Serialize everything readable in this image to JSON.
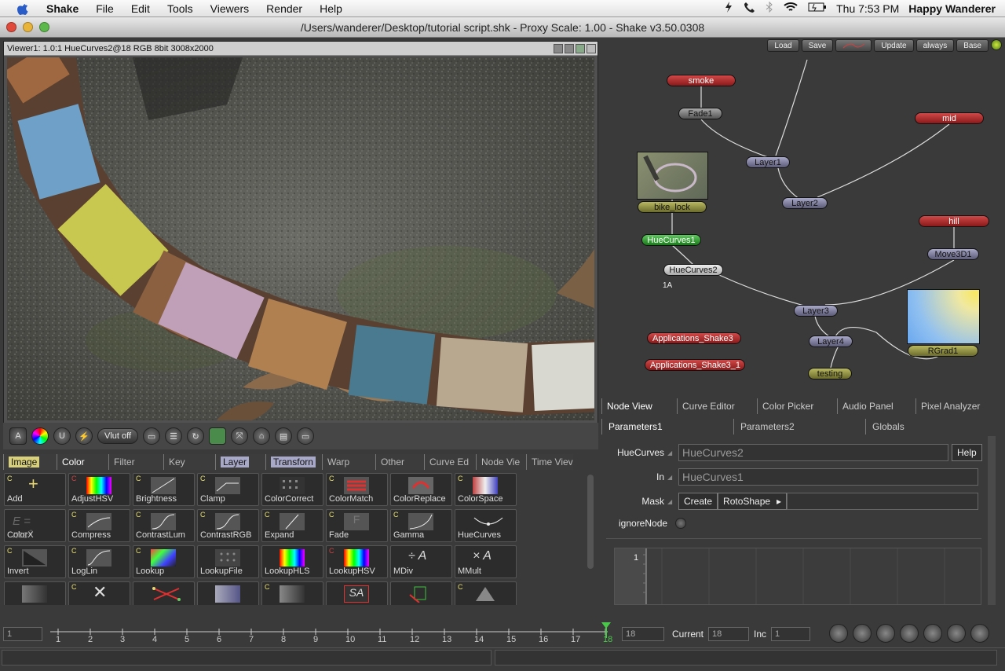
{
  "menubar": {
    "app": "Shake",
    "items": [
      "File",
      "Edit",
      "Tools",
      "Viewers",
      "Render",
      "Help"
    ],
    "clock": "Thu 7:53 PM",
    "user": "Happy Wanderer",
    "status_icons": [
      "spotlight-icon",
      "phone-icon",
      "bluetooth-icon",
      "wifi-icon",
      "battery-icon"
    ]
  },
  "window": {
    "title": "/Users/wanderer/Desktop/tutorial script.shk - Proxy Scale: 1.00 - Shake v3.50.0308"
  },
  "viewer": {
    "header": "Viewer1: 1.0:1 HueCurves2@18 RGB 8bit 3008x2000",
    "vlut_label": "Vlut off"
  },
  "tool_tabs": [
    {
      "label": "Image",
      "style": "hl"
    },
    {
      "label": "Color",
      "style": "sel"
    },
    {
      "label": "Filter",
      "style": ""
    },
    {
      "label": "Key",
      "style": ""
    },
    {
      "label": "Layer",
      "style": "hlb"
    },
    {
      "label": "Transforn",
      "style": "hlb"
    },
    {
      "label": "Warp",
      "style": ""
    },
    {
      "label": "Other",
      "style": ""
    },
    {
      "label": "Curve Ed",
      "style": ""
    },
    {
      "label": "Node Vie",
      "style": ""
    },
    {
      "label": "Time Viev",
      "style": ""
    }
  ],
  "tools": [
    {
      "label": "Add",
      "c": "C",
      "cred": false
    },
    {
      "label": "AdjustHSV",
      "c": "C",
      "cred": true
    },
    {
      "label": "Brightness",
      "c": "C",
      "cred": false
    },
    {
      "label": "Clamp",
      "c": "C",
      "cred": false
    },
    {
      "label": "ColorCorrect",
      "c": "",
      "cred": false
    },
    {
      "label": "ColorMatch",
      "c": "C",
      "cred": false
    },
    {
      "label": "ColorReplace",
      "c": "",
      "cred": false
    },
    {
      "label": "ColorSpace",
      "c": "C",
      "cred": false
    },
    {
      "label": "ColorX",
      "c": "",
      "cred": false
    },
    {
      "label": "Compress",
      "c": "C",
      "cred": false
    },
    {
      "label": "ContrastLum",
      "c": "C",
      "cred": false
    },
    {
      "label": "ContrastRGB",
      "c": "C",
      "cred": false
    },
    {
      "label": "Expand",
      "c": "C",
      "cred": false
    },
    {
      "label": "Fade",
      "c": "C",
      "cred": false
    },
    {
      "label": "Gamma",
      "c": "C",
      "cred": false
    },
    {
      "label": "HueCurves",
      "c": "",
      "cred": false
    },
    {
      "label": "Invert",
      "c": "C",
      "cred": false
    },
    {
      "label": "LogLin",
      "c": "C",
      "cred": false
    },
    {
      "label": "Lookup",
      "c": "C",
      "cred": false
    },
    {
      "label": "LookupFile",
      "c": "",
      "cred": false
    },
    {
      "label": "LookupHLS",
      "c": "",
      "cred": false
    },
    {
      "label": "LookupHSV",
      "c": "C",
      "cred": true
    },
    {
      "label": "MDiv",
      "c": "",
      "cred": false
    },
    {
      "label": "MMult",
      "c": "",
      "cred": false
    },
    {
      "label": "",
      "c": "",
      "cred": false
    },
    {
      "label": "",
      "c": "C",
      "cred": false
    },
    {
      "label": "",
      "c": "",
      "cred": false
    },
    {
      "label": "",
      "c": "",
      "cred": false
    },
    {
      "label": "",
      "c": "C",
      "cred": false
    },
    {
      "label": "",
      "c": "",
      "cred": false
    },
    {
      "label": "",
      "c": "",
      "cred": false
    },
    {
      "label": "",
      "c": "C",
      "cred": false
    }
  ],
  "tool_icon_text": {
    "colorx": "E = mc²",
    "mdiv": "÷ A",
    "mmult": "× A",
    "fade": "F",
    "sa": "SA"
  },
  "node_buttons": [
    "Load",
    "Save",
    "Update",
    "always",
    "Base"
  ],
  "nodes": {
    "smoke": "smoke",
    "fade1": "Fade1",
    "layer1": "Layer1",
    "mid": "mid",
    "bike_lock": "bike_lock",
    "layer2": "Layer2",
    "huecurves1": "HueCurves1",
    "hill": "hill",
    "huecurves2": "HueCurves2",
    "move3d1": "Move3D1",
    "label_1a": "1A",
    "layer3": "Layer3",
    "apps1": "Applications_Shake3",
    "layer4": "Layer4",
    "apps2": "Applications_Shake3_1",
    "rgrad1": "RGrad1",
    "testing": "testing"
  },
  "node_tabs": [
    "Node View",
    "Curve Editor",
    "Color Picker",
    "Audio Panel",
    "Pixel Analyzer"
  ],
  "param_tabs": [
    "Parameters1",
    "Parameters2",
    "Globals"
  ],
  "params": {
    "huecurves_label": "HueCurves",
    "huecurves_value": "HueCurves2",
    "help": "Help",
    "in_label": "In",
    "in_value": "HueCurves1",
    "mask_label": "Mask",
    "create": "Create",
    "rotoshape": "RotoShape",
    "ignore_label": "ignoreNode",
    "curve_axis": "1"
  },
  "timeline": {
    "start": "1",
    "end": "18",
    "current_label": "Current",
    "current": "18",
    "inc_label": "Inc",
    "inc": "1",
    "ticks": [
      "1",
      "2",
      "3",
      "4",
      "5",
      "6",
      "7",
      "8",
      "9",
      "10",
      "11",
      "12",
      "13",
      "14",
      "15",
      "16",
      "17",
      "18"
    ]
  }
}
